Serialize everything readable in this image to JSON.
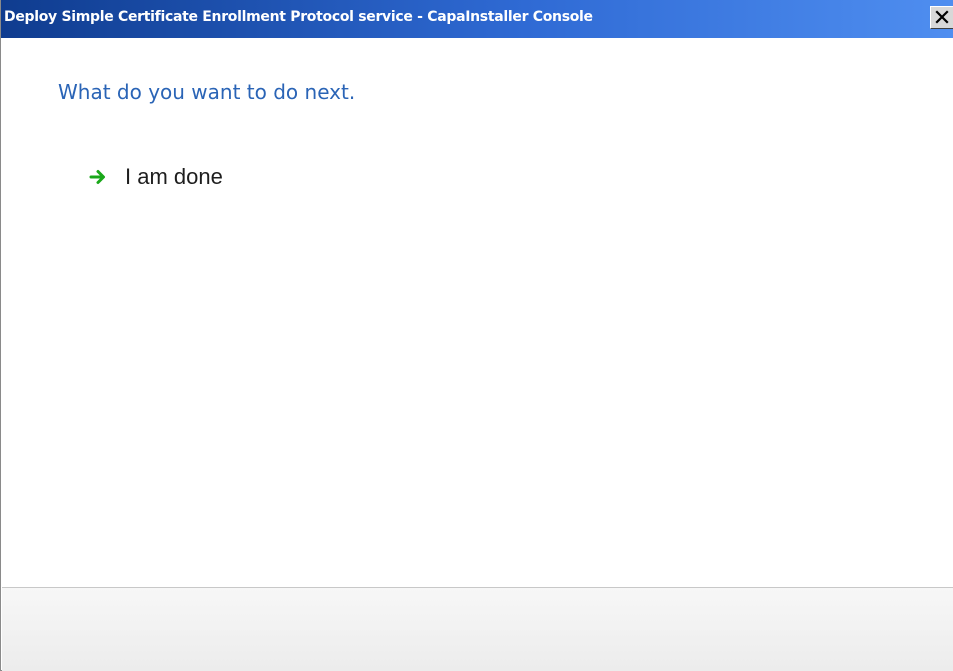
{
  "window": {
    "title": "Deploy Simple Certificate Enrollment Protocol service - CapaInstaller Console",
    "close_icon": "close-icon"
  },
  "content": {
    "heading": "What do you want to do next.",
    "tasks": [
      {
        "label": "I am done",
        "icon": "green-arrow-right-icon"
      }
    ]
  },
  "colors": {
    "title_bar_start": "#0f3c8f",
    "title_bar_end": "#4f8ef0",
    "heading": "#2a64b6",
    "arrow": "#1aa81a"
  }
}
